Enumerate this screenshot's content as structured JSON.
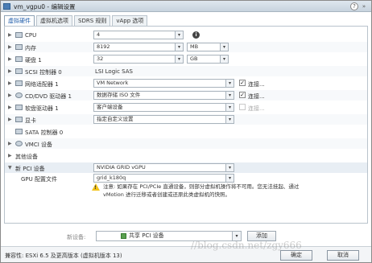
{
  "window": {
    "title": "vm_vgpu0 - 编辑设置",
    "help": "?",
    "more": "»"
  },
  "tabs": [
    {
      "label": "虚拟硬件",
      "active": true
    },
    {
      "label": "虚拟机选项",
      "active": false
    },
    {
      "label": "SDRS 规则",
      "active": false
    },
    {
      "label": "vApp 选项",
      "active": false
    }
  ],
  "hardware": {
    "cpu": {
      "label": "CPU",
      "value": "4"
    },
    "memory": {
      "label": "内存",
      "value": "8192",
      "unit": "MB"
    },
    "disk": {
      "label": "硬盘 1",
      "value": "32",
      "unit": "GB"
    },
    "scsi": {
      "label": "SCSI 控制器 0",
      "value": "LSI Logic SAS"
    },
    "network": {
      "label": "网络适配器 1",
      "value": "VM Network",
      "connect": "连接..."
    },
    "cdrom": {
      "label": "CD/DVD 驱动器 1",
      "value": "数据存储 ISO 文件",
      "connect": "连接..."
    },
    "floppy": {
      "label": "软盘驱动器 1",
      "value": "客户端设备",
      "connect": "连接..."
    },
    "video": {
      "label": "显卡",
      "value": "指定自定义设置"
    },
    "sata": {
      "label": "SATA 控制器 0"
    },
    "vmci": {
      "label": "VMCI 设备"
    },
    "other": {
      "label": "其他设备"
    },
    "pci": {
      "label": "新 PCI 设备",
      "value": "NVIDIA GRID vGPU"
    },
    "gpu_profile": {
      "label": "GPU 配置文件",
      "value": "grid_k180q"
    },
    "warning": "注意: 如果存在 PCI/PCIe 直通设备，则部分虚拟机操作将不可用。您无法挂起、通过 vMotion 进行迁移或者创建或还原此类虚拟机的快照。"
  },
  "new_device": {
    "label": "新设备:",
    "value": "共享 PCI 设备",
    "add_label": "添加"
  },
  "footer": {
    "compat": "兼容性: ESXi 6.5 及更高版本 (虚拟机版本 13)",
    "ok": "确定",
    "cancel": "取消"
  },
  "watermark": "//blog.csdn.net/zgy666"
}
